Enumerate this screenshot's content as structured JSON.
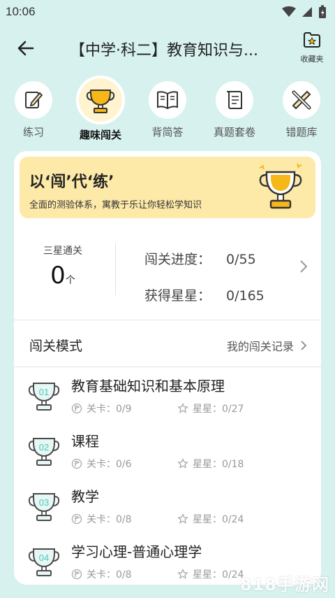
{
  "status_bar": {
    "time": "10:06"
  },
  "header": {
    "title": "【中学·科二】教育知识与...",
    "favorite_label": "收藏夹"
  },
  "tabs": [
    {
      "label": "练习",
      "icon": "pencil-note-icon"
    },
    {
      "label": "趣味闯关",
      "icon": "trophy-icon",
      "active": true
    },
    {
      "label": "背简答",
      "icon": "open-book-icon"
    },
    {
      "label": "真题套卷",
      "icon": "scroll-icon"
    },
    {
      "label": "错题库",
      "icon": "pencil-ruler-icon"
    }
  ],
  "banner": {
    "title": "以‘闯’代‘练’",
    "subtitle": "全面的测验体系，寓教于乐让你轻松学知识"
  },
  "stats": {
    "three_star_label": "三星通关",
    "three_star_value": "0",
    "three_star_unit": "个",
    "progress_label": "闯关进度：",
    "progress_value": "0/55",
    "stars_label": "获得星星：",
    "stars_value": "0/165"
  },
  "mode": {
    "title": "闯关模式",
    "record_link": "我的闯关记录"
  },
  "levels": [
    {
      "num": "01",
      "title": "教育基础知识和基本原理",
      "level_text": "关卡：0/9",
      "star_text": "星星：0/27"
    },
    {
      "num": "02",
      "title": "课程",
      "level_text": "关卡：0/6",
      "star_text": "星星：0/18"
    },
    {
      "num": "03",
      "title": "教学",
      "level_text": "关卡：0/8",
      "star_text": "星星：0/24"
    },
    {
      "num": "04",
      "title": "学习心理-普通心理学",
      "level_text": "关卡：0/8",
      "star_text": "星星：0/24"
    }
  ],
  "watermark": "818手游网",
  "colors": {
    "background": "#d6f1ee",
    "banner": "#fde9a8",
    "trophy_gold": "#f5b818",
    "accent_teal": "#4fc7b8"
  }
}
